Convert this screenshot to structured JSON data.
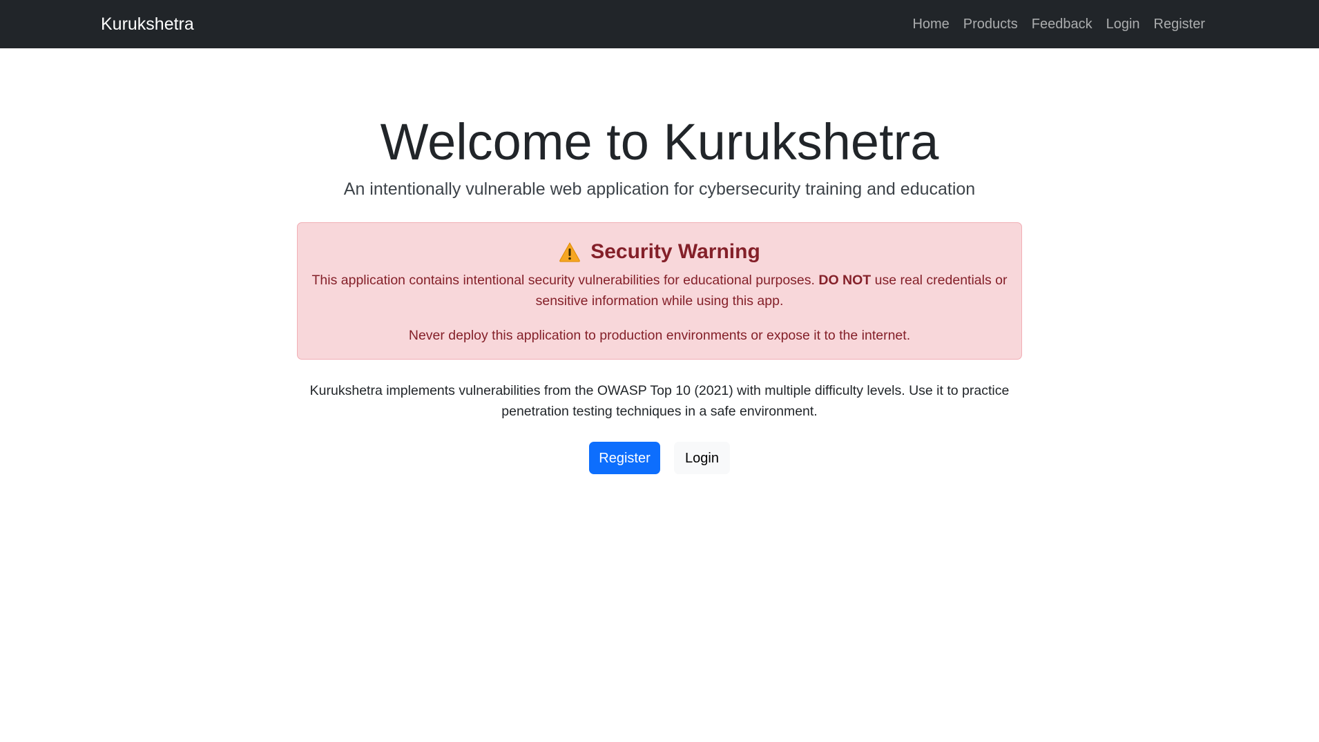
{
  "navbar": {
    "brand": "Kurukshetra",
    "links": [
      "Home",
      "Products",
      "Feedback",
      "Login",
      "Register"
    ]
  },
  "hero": {
    "title": "Welcome to Kurukshetra",
    "subtitle": "An intentionally vulnerable web application for cybersecurity training and education"
  },
  "alert": {
    "icon": "warning-icon",
    "heading": "Security Warning",
    "p1_before": "This application contains intentional security vulnerabilities for educational purposes. ",
    "p1_bold": "DO NOT",
    "p1_after": " use real credentials or sensitive information while using this app.",
    "p2": "Never deploy this application to production environments or expose it to the internet."
  },
  "lead": "Kurukshetra implements vulnerabilities from the OWASP Top 10 (2021) with multiple difficulty levels. Use it to practice penetration testing techniques in a safe environment.",
  "actions": {
    "register_label": "Register",
    "login_label": "Login"
  },
  "colors": {
    "navbar_bg": "#212529",
    "alert_bg": "#f8d7da",
    "alert_text": "#842029",
    "primary": "#0d6efd"
  }
}
